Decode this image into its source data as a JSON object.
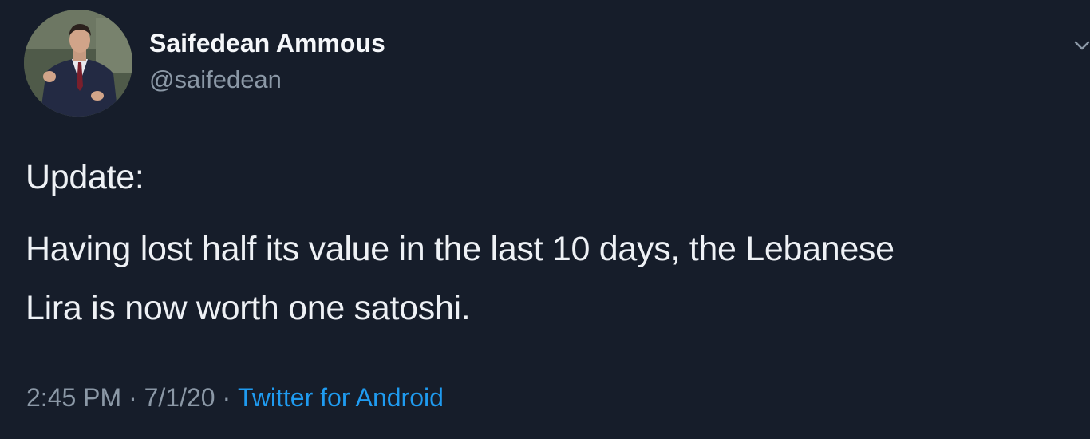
{
  "author": {
    "name": "Saifedean Ammous",
    "handle": "@saifedean"
  },
  "tweet": {
    "lines": [
      "Update:",
      "Having lost half its value in the last 10 days, the Lebanese",
      "Lira is now worth one satoshi."
    ]
  },
  "meta": {
    "time": "2:45 PM",
    "separator": "·",
    "date": "7/1/20",
    "source": "Twitter for Android"
  },
  "icons": {
    "caret": "chevron-down-icon"
  },
  "colors": {
    "background": "#161d2a",
    "text": "#eef1f5",
    "muted": "#8b98a6",
    "link": "#1f9bf0"
  }
}
